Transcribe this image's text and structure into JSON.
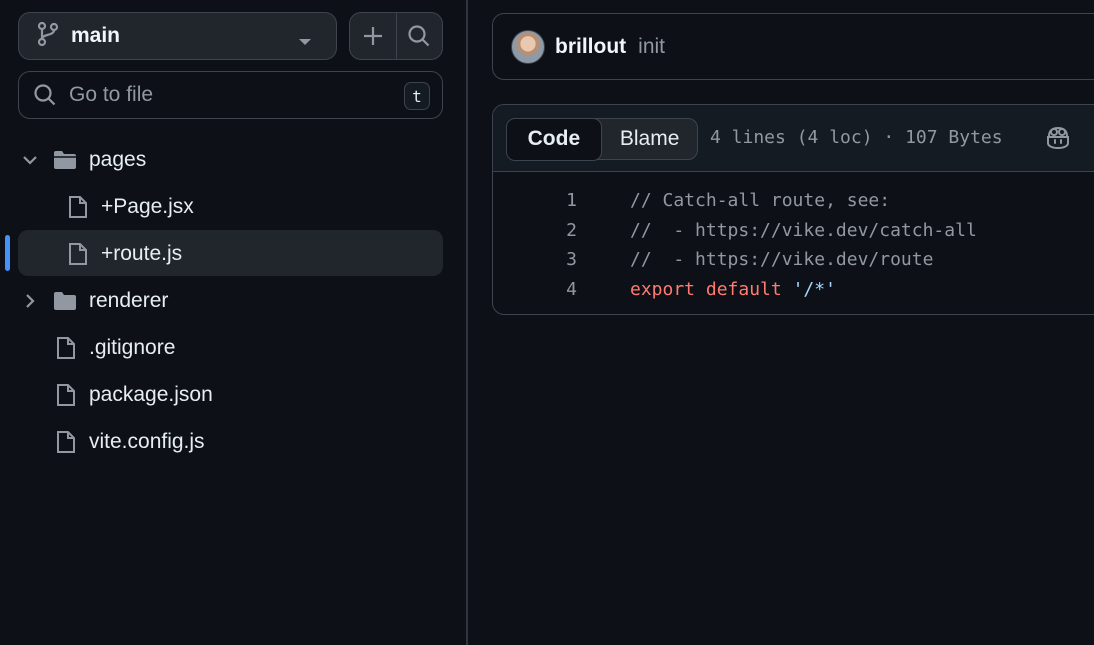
{
  "sidebar": {
    "branch": "main",
    "search": {
      "placeholder": "Go to file",
      "shortcut": "t"
    },
    "tree": [
      {
        "name": "pages",
        "type": "folder",
        "expanded": true,
        "depth": 0
      },
      {
        "name": "+Page.jsx",
        "type": "file",
        "depth": 1
      },
      {
        "name": "+route.js",
        "type": "file",
        "depth": 1,
        "selected": true
      },
      {
        "name": "renderer",
        "type": "folder",
        "expanded": false,
        "depth": 0
      },
      {
        "name": ".gitignore",
        "type": "file",
        "depth": 0
      },
      {
        "name": "package.json",
        "type": "file",
        "depth": 0
      },
      {
        "name": "vite.config.js",
        "type": "file",
        "depth": 0
      }
    ]
  },
  "commit": {
    "author": "brillout",
    "message": "init"
  },
  "file": {
    "tabs": {
      "code": "Code",
      "blame": "Blame"
    },
    "info": "4 lines (4 loc) · 107 Bytes",
    "lines": [
      {
        "num": "1",
        "text": "// Catch-all route, see:"
      },
      {
        "num": "2",
        "text": "//  - https://vike.dev/catch-all"
      },
      {
        "num": "3",
        "text": "//  - https://vike.dev/route"
      },
      {
        "num": "4",
        "kw": "export default",
        "str": "'/*'"
      }
    ]
  },
  "colors": {
    "accent": "#4493f8",
    "keyword": "#ff7b72",
    "string": "#a5d6ff"
  }
}
